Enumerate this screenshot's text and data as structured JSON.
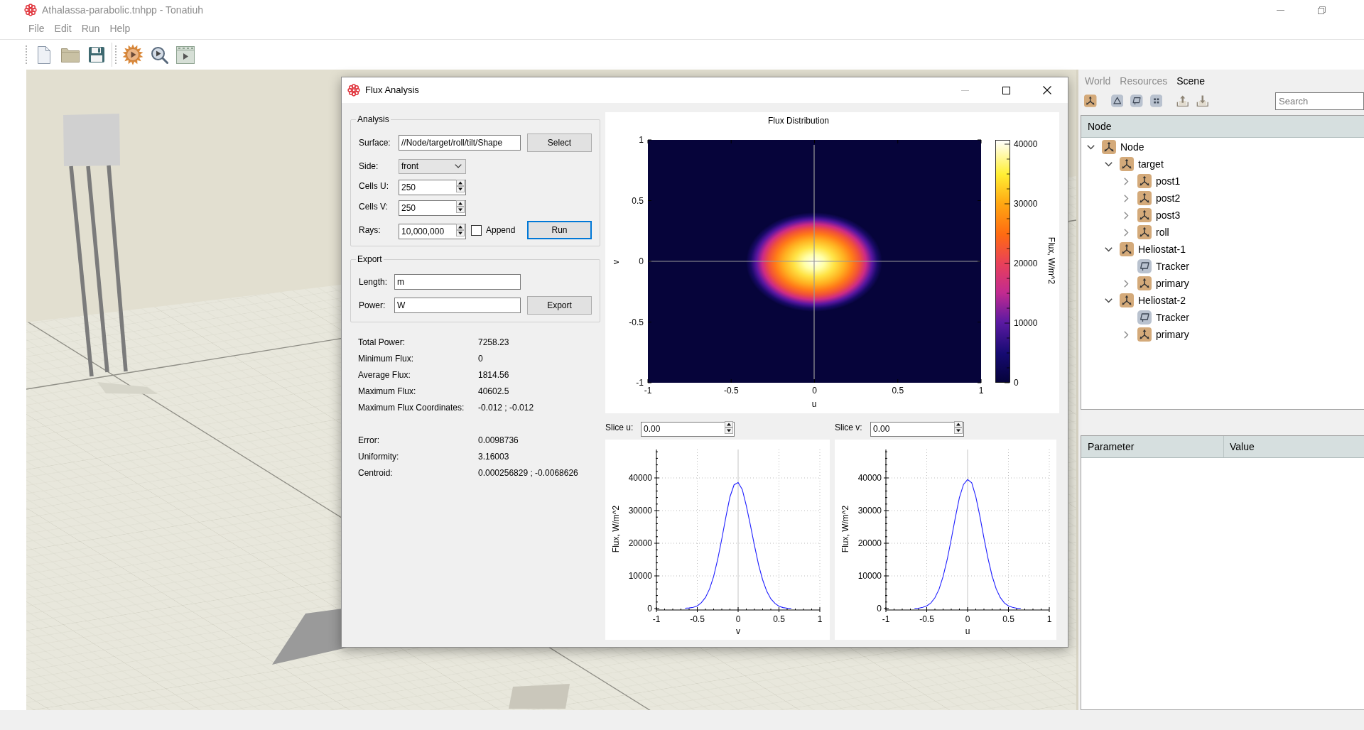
{
  "window": {
    "title": "Athalassa-parabolic.tnhpp - Tonatiuh"
  },
  "menu": [
    {
      "label": "File"
    },
    {
      "label": "Edit"
    },
    {
      "label": "Run"
    },
    {
      "label": "Help"
    }
  ],
  "dialog": {
    "title": "Flux Analysis",
    "analysis": {
      "title": "Analysis",
      "surface": {
        "label": "Surface:",
        "value": "//Node/target/roll/tilt/Shape"
      },
      "select_button": {
        "label": "Select",
        "focused": false
      },
      "side": {
        "label": "Side:",
        "value": "front"
      },
      "cells_u": {
        "label": "Cells U:",
        "value": "250"
      },
      "cells_v": {
        "label": "Cells V:",
        "value": "250"
      },
      "rays": {
        "label": "Rays:",
        "value": "10,000,000"
      },
      "append": {
        "label": "Append",
        "checked": false
      },
      "run_button": {
        "label": "Run",
        "focused": true
      }
    },
    "export": {
      "title": "Export",
      "length": {
        "label": "Length:",
        "value": "m"
      },
      "power": {
        "label": "Power:",
        "value": "W"
      },
      "export_button": {
        "label": "Export",
        "focused": false
      }
    },
    "results": [
      [
        {
          "label": "Total Power:",
          "value": "7258.23"
        },
        {
          "label": "Minimum Flux:",
          "value": "0"
        },
        {
          "label": "Average Flux:",
          "value": "1814.56"
        },
        {
          "label": "Maximum Flux:",
          "value": "40602.5"
        },
        {
          "label": "Maximum Flux Coordinates:",
          "value": "-0.012 ; -0.012"
        }
      ],
      [
        {
          "label": "Error:",
          "value": "0.0098736"
        },
        {
          "label": "Uniformity:",
          "value": "3.16003"
        },
        {
          "label": "Centroid:",
          "value": "0.000256829 ; -0.0068626"
        }
      ]
    ],
    "flux_distribution": {
      "title": "Flux Distribution",
      "xlabel": "u",
      "ylabel": "v",
      "x_tick_labels": [
        "-1",
        "-0.5",
        "0",
        "0.5",
        "1"
      ],
      "y_tick_labels": [
        "1",
        "0.5",
        "0",
        "-0.5",
        "-1"
      ],
      "colorbar": {
        "label": "Flux, W/m^2",
        "tick_labels": [
          "40000",
          "30000",
          "20000",
          "10000",
          "0"
        ]
      }
    },
    "slices": [
      {
        "label": "Slice u:",
        "value": "0.00",
        "chart_data": [
          {
            "type": "line",
            "xlabel": "v",
            "ylabel": "Flux, W/m^2",
            "x": [
              -0.65,
              -0.6,
              -0.55,
              -0.5,
              -0.45,
              -0.4,
              -0.35,
              -0.3,
              -0.25,
              -0.2,
              -0.15,
              -0.1,
              -0.05,
              0,
              0.05,
              0.1,
              0.15,
              0.2,
              0.25,
              0.3,
              0.35,
              0.4,
              0.45,
              0.5,
              0.55,
              0.6,
              0.65
            ],
            "values": [
              100,
              200,
              400,
              800,
              1800,
              3400,
              6000,
              9800,
              15100,
              21300,
              28100,
              34200,
              37900,
              38600,
              36500,
              31500,
              25500,
              19300,
              13400,
              8800,
              5300,
              3000,
              1600,
              700,
              300,
              100,
              100
            ],
            "color": "#1f1fff",
            "xlim": [
              -1,
              1
            ],
            "ylim": [
              0,
              48700
            ],
            "xticks": [
              -1,
              -0.5,
              0,
              0.5,
              1
            ],
            "yticks": [
              0,
              10000,
              20000,
              30000,
              40000
            ],
            "grid": true
          }
        ]
      },
      {
        "label": "Slice v:",
        "value": "0.00",
        "chart_data": [
          {
            "type": "line",
            "xlabel": "u",
            "ylabel": "Flux, W/m^2",
            "x": [
              -0.65,
              -0.6,
              -0.55,
              -0.5,
              -0.45,
              -0.4,
              -0.35,
              -0.3,
              -0.25,
              -0.2,
              -0.15,
              -0.1,
              -0.05,
              0,
              0.05,
              0.1,
              0.15,
              0.2,
              0.25,
              0.3,
              0.35,
              0.4,
              0.45,
              0.5,
              0.55,
              0.6,
              0.65
            ],
            "values": [
              100,
              100,
              400,
              800,
              1700,
              3300,
              5900,
              9800,
              15000,
              21200,
              27900,
              34000,
              38000,
              39500,
              38500,
              34300,
              28300,
              21600,
              15300,
              10000,
              6000,
              3400,
              1700,
              800,
              400,
              100,
              100
            ],
            "color": "#1f1fff",
            "xlim": [
              -1,
              1
            ],
            "ylim": [
              0,
              48700
            ],
            "xticks": [
              -1,
              -0.5,
              0,
              0.5,
              1
            ],
            "yticks": [
              0,
              10000,
              20000,
              30000,
              40000
            ],
            "grid": true
          }
        ]
      }
    ]
  },
  "side_panel": {
    "tabs": [
      {
        "label": "World",
        "selected": false
      },
      {
        "label": "Resources",
        "selected": false
      },
      {
        "label": "Scene",
        "selected": true
      }
    ],
    "search": {
      "placeholder": "Search"
    },
    "tree": {
      "header": "Node",
      "items": [
        {
          "label": "Node",
          "kind": "node",
          "expanded": true,
          "children": [
            {
              "label": "target",
              "kind": "node",
              "expanded": true,
              "children": [
                {
                  "label": "post1",
                  "kind": "node",
                  "expanded": false
                },
                {
                  "label": "post2",
                  "kind": "node",
                  "expanded": false
                },
                {
                  "label": "post3",
                  "kind": "node",
                  "expanded": false
                },
                {
                  "label": "roll",
                  "kind": "node",
                  "expanded": false
                }
              ]
            },
            {
              "label": "Heliostat-1",
              "kind": "node",
              "expanded": true,
              "children": [
                {
                  "label": "Tracker",
                  "kind": "tracker",
                  "expanded": false
                },
                {
                  "label": "primary",
                  "kind": "node",
                  "expanded": false
                }
              ]
            },
            {
              "label": "Heliostat-2",
              "kind": "node",
              "expanded": true,
              "children": [
                {
                  "label": "Tracker",
                  "kind": "tracker",
                  "expanded": false
                },
                {
                  "label": "primary",
                  "kind": "node",
                  "expanded": false
                }
              ]
            }
          ]
        }
      ]
    },
    "parameters": {
      "columns": [
        "Parameter",
        "Value"
      ]
    }
  }
}
